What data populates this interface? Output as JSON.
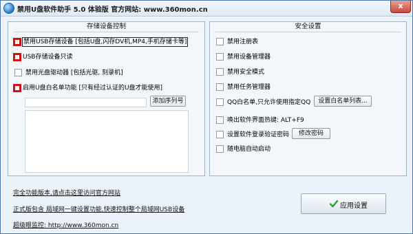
{
  "window": {
    "title": "禁用U盘软件助手 5.0 体验版  官方网站: www.360mon.cn",
    "close_glyph": "x"
  },
  "storage_group": {
    "title": "存储设备控制",
    "options": [
      {
        "label": "禁用USB存储设备 [包括U盘,闪存DV机,MP4,手机存储卡等]",
        "checked": false,
        "highlight": true
      },
      {
        "label": "USB存储设备只读",
        "checked": false,
        "highlight": true
      },
      {
        "label": "禁用光盘驱动器 [包括光驱, 刻录机]",
        "checked": false,
        "highlight": false
      },
      {
        "label": "启用U盘白名单功能 [只有经过认证的U盘才能使用]",
        "checked": false,
        "highlight": true
      }
    ],
    "serial_input_value": "",
    "add_serial_button": "添加序列号"
  },
  "security_group": {
    "title": "安全设置",
    "options": [
      {
        "label": "禁用注册表",
        "checked": false
      },
      {
        "label": "禁用设备管理器",
        "checked": false
      },
      {
        "label": "禁用安全模式",
        "checked": false
      },
      {
        "label": "禁用任务管理器",
        "checked": false
      },
      {
        "label": "QQ白名单,只允许使用指定QQ",
        "checked": false
      },
      {
        "label": "唤出软件界面热键: ALT+F9",
        "checked": false
      },
      {
        "label": "设置软件登录验证密码",
        "checked": false
      },
      {
        "label": "随电脑自动启动",
        "checked": false
      }
    ],
    "qq_whitelist_button": "设置白名单列表...",
    "change_password_button": "修改密码"
  },
  "footer": {
    "full_version_link": "完全功能版本,请点击这里访问官方网站",
    "lan_info_link": "正式版包含 局域网一键设置功能,快速控制整个局域网USB设备",
    "super_monitor_link": "超级眼监控: http://www.360mon.cn",
    "apply_button": "应用设置"
  },
  "colors": {
    "highlight_border": "#d01111",
    "window_background": "#ecf2f9",
    "check_icon": "#2e9e2e"
  }
}
